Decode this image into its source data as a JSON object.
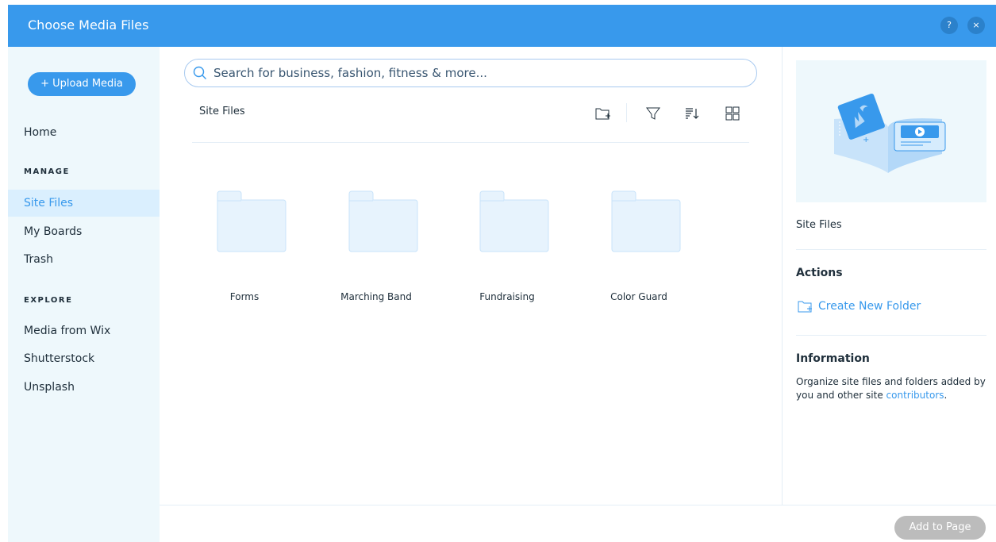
{
  "header": {
    "title": "Choose Media Files",
    "help_label": "?",
    "close_label": "×"
  },
  "sidebar": {
    "upload_label": "+ Upload Media",
    "home": "Home",
    "manage_heading": "MANAGE",
    "manage_items": [
      "Site Files",
      "My Boards",
      "Trash"
    ],
    "explore_heading": "EXPLORE",
    "explore_items": [
      "Media from Wix",
      "Shutterstock",
      "Unsplash"
    ]
  },
  "search": {
    "placeholder": "Search for business, fashion, fitness & more..."
  },
  "main": {
    "breadcrumb": "Site Files",
    "tools": [
      "new-folder-icon",
      "filter-icon",
      "sort-icon",
      "grid-view-icon"
    ],
    "folders": [
      "Forms",
      "Marching Band",
      "Fundraising",
      "Color Guard"
    ]
  },
  "right_panel": {
    "title": "Site Files",
    "actions_heading": "Actions",
    "create_folder": "Create New Folder",
    "info_heading": "Information",
    "info_text": "Organize site files and folders added by you and other site ",
    "info_link": "contributors",
    "info_end": "."
  },
  "footer": {
    "add_label": "Add to Page"
  },
  "colors": {
    "accent": "#3899ec",
    "sidebar_bg": "#eef8fc",
    "active_bg": "#daeffe",
    "disabled_btn": "#bcbcbc"
  }
}
